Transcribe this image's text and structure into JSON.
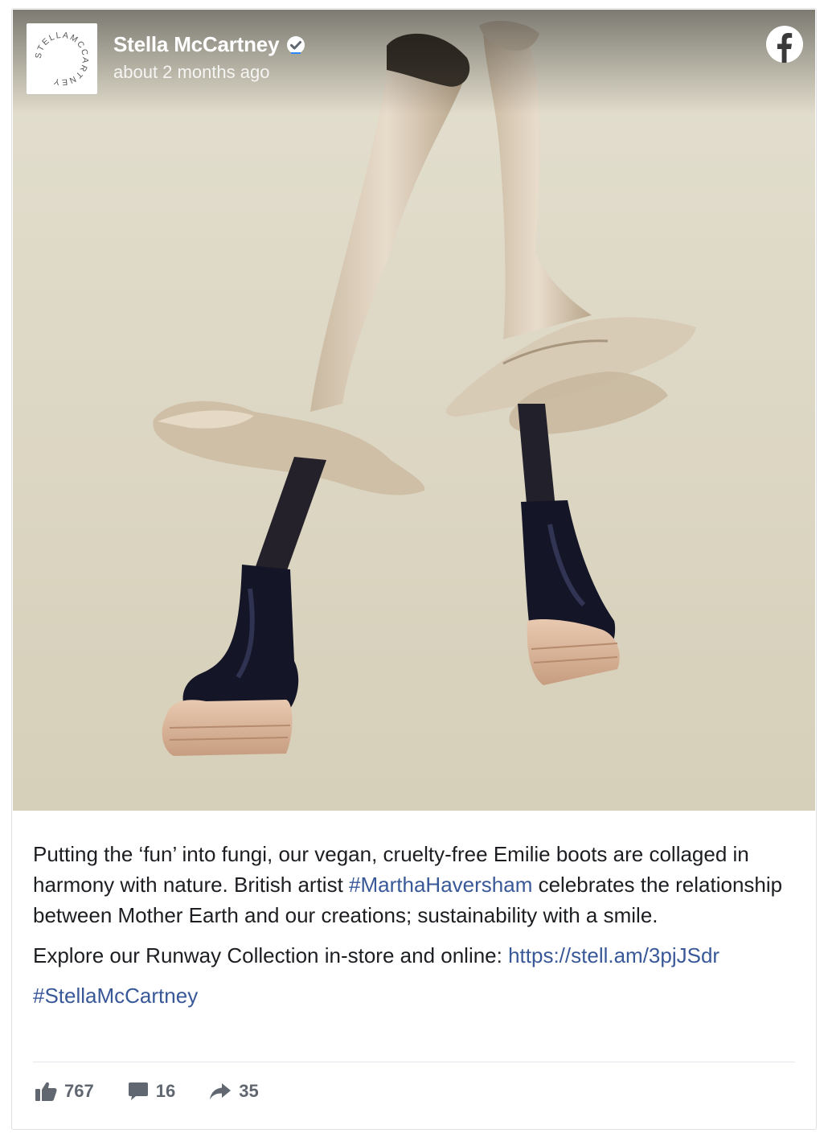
{
  "post": {
    "page_name": "Stella McCartney",
    "timestamp": "about 2 months ago",
    "avatar_text": "STELLAMCCARTNEY",
    "text_part1": "Putting the ‘fun’ into fungi, our vegan, cruelty-free Emilie boots are collaged in harmony with nature. British artist ",
    "hashtag_artist": "#MarthaHaversham",
    "text_part2": " celebrates the relationship between Mother Earth and our creations; sustainability with a smile.",
    "explore_text": "Explore our Runway Collection in-store and online: ",
    "link_url": "https://stell.am/3pjJSdr",
    "hashtag_brand": "#StellaMcCartney"
  },
  "stats": {
    "likes": "767",
    "comments": "16",
    "shares": "35"
  },
  "icons": {
    "platform": "facebook-icon",
    "verified": "verified-badge-icon",
    "like": "thumbs-up-icon",
    "comment": "comment-bubble-icon",
    "share": "share-arrow-icon"
  },
  "colors": {
    "link": "#385898",
    "stat_gray": "#606770",
    "photo_background": "#dcd6c4"
  }
}
